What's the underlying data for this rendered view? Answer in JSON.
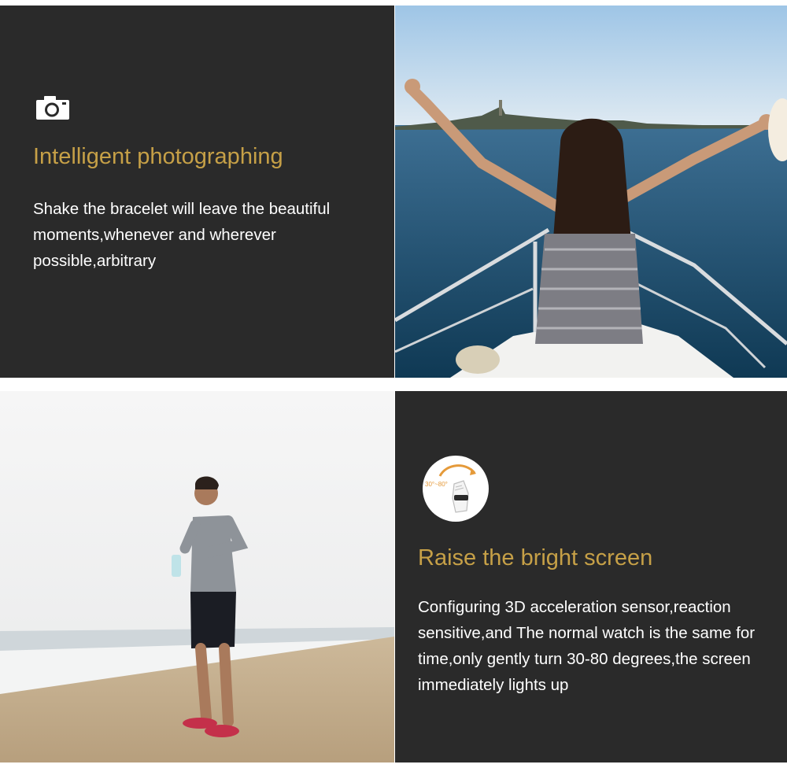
{
  "feature_photographing": {
    "icon": "camera-icon",
    "title": "Intelligent photographing",
    "description": "Shake the bracelet will leave the beautiful moments,whenever and wherever possible,arbitrary"
  },
  "feature_raise_screen": {
    "icon": "raise-wrist-icon",
    "icon_label": "30°~80°",
    "title": "Raise the bright screen",
    "description": "Configuring 3D acceleration sensor,reaction sensitive,and The normal watch is the same for time,only gently turn 30-80 degrees,the screen immediately lights up"
  },
  "colors": {
    "panel_background": "#2a2a2a",
    "title_gold": "#c6a047",
    "body_text": "#ffffff"
  }
}
